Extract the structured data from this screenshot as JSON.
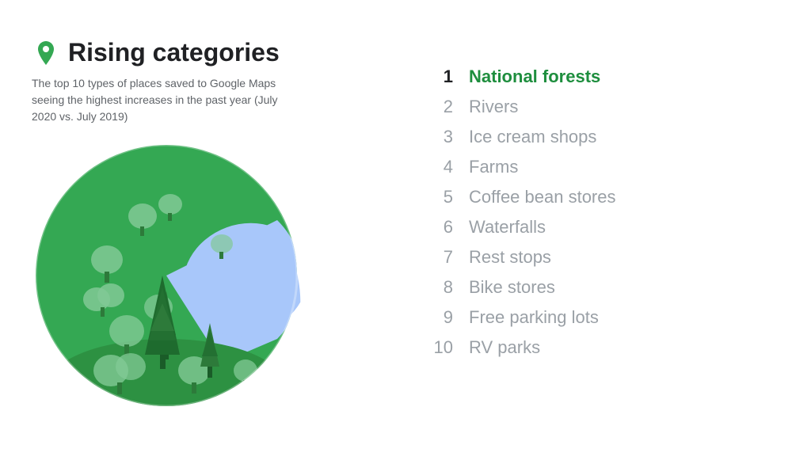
{
  "header": {
    "title": "Rising categories",
    "subtitle": "The top 10 types of places saved to Google Maps seeing the highest increases in the past year (July 2020 vs. July 2019)"
  },
  "rankings": [
    {
      "rank": "1",
      "label": "National forests",
      "highlight": true
    },
    {
      "rank": "2",
      "label": "Rivers",
      "highlight": false
    },
    {
      "rank": "3",
      "label": "Ice cream shops",
      "highlight": false
    },
    {
      "rank": "4",
      "label": "Farms",
      "highlight": false
    },
    {
      "rank": "5",
      "label": "Coffee bean stores",
      "highlight": false
    },
    {
      "rank": "6",
      "label": "Waterfalls",
      "highlight": false
    },
    {
      "rank": "7",
      "label": "Rest stops",
      "highlight": false
    },
    {
      "rank": "8",
      "label": "Bike stores",
      "highlight": false
    },
    {
      "rank": "9",
      "label": "Free parking lots",
      "highlight": false
    },
    {
      "rank": "10",
      "label": "RV parks",
      "highlight": false
    }
  ],
  "colors": {
    "green_primary": "#34a853",
    "green_dark": "#1e8e3e",
    "green_forest": "#2d7a3a",
    "green_light": "#81c995",
    "blue_lake": "#a8c7fa",
    "gray_text": "#9aa0a6",
    "dark_text": "#202124"
  }
}
